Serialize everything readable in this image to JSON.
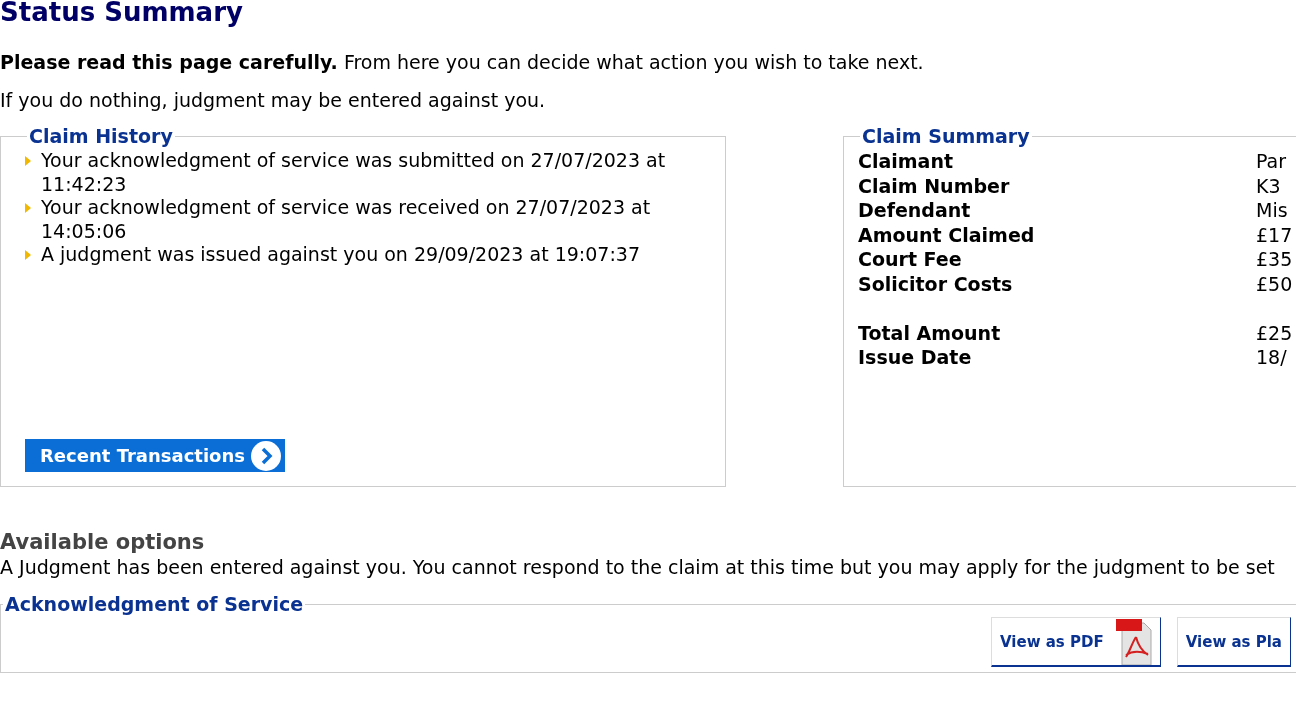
{
  "title": "Status Summary",
  "intro": "**Please read this page carefully.** From here you can decide what action you wish to take next.",
  "warning": "If you do nothing, judgment may be entered against you.",
  "claim_history": {
    "title": "Claim History",
    "events": [
      "Your acknowledgment of service was submitted on 27/07/2023 at 11:42:23",
      "Your acknowledgment of service was received on 27/07/2023 at 14:05:06",
      "A judgment was issued against you on 29/09/2023 at 19:07:37"
    ],
    "button": "Recent Transactions"
  },
  "claim_summary": {
    "title": "Claim Summary",
    "groups": [
      {
        "rows": [
          {
            "label": "Claimant",
            "value": "Par"
          },
          {
            "label": "Claim Number",
            "value": "K3"
          },
          {
            "label": "Defendant",
            "value": "Mis"
          },
          {
            "label": "Amount Claimed",
            "value": "£17"
          },
          {
            "label": "Court Fee",
            "value": "£35"
          },
          {
            "label": "Solicitor Costs",
            "value": "£50"
          }
        ]
      },
      {
        "rows": [
          {
            "label": "Total Amount",
            "value": "£25"
          },
          {
            "label": "Issue Date",
            "value": "18/"
          }
        ]
      }
    ]
  },
  "options": {
    "title": "Available options",
    "text": "A Judgment has been entered against you. You cannot respond to the claim at this time but you may apply for the judgment to be set"
  },
  "acknowledgment": {
    "title": "Acknowledgment of Service",
    "buttons": [
      {
        "label": "View as PDF",
        "kind": "pdf"
      },
      {
        "label": "View as Pla",
        "kind": "plain"
      }
    ]
  }
}
